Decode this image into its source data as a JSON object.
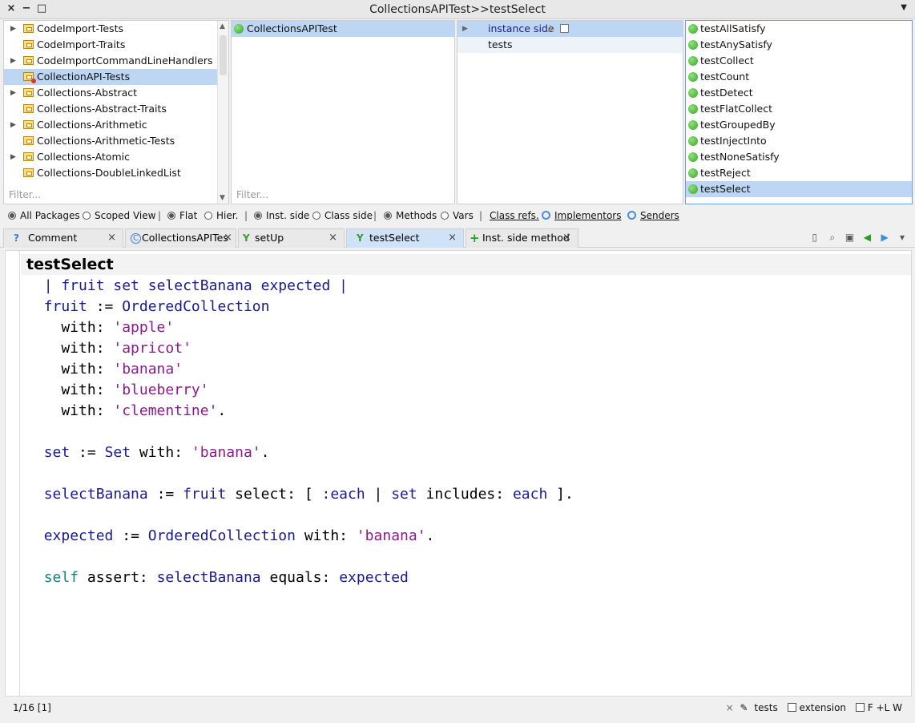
{
  "window": {
    "title": "CollectionsAPITest>>testSelect"
  },
  "packages": {
    "items": [
      {
        "label": "CodeImport-Tests",
        "expandable": true
      },
      {
        "label": "CodeImport-Traits",
        "expandable": false
      },
      {
        "label": "CodeImportCommandLineHandlers",
        "expandable": true
      },
      {
        "label": "CollectionAPI-Tests",
        "expandable": false
      },
      {
        "label": "Collections-Abstract",
        "expandable": true
      },
      {
        "label": "Collections-Abstract-Traits",
        "expandable": false
      },
      {
        "label": "Collections-Arithmetic",
        "expandable": true
      },
      {
        "label": "Collections-Arithmetic-Tests",
        "expandable": false
      },
      {
        "label": "Collections-Atomic",
        "expandable": true
      },
      {
        "label": "Collections-DoubleLinkedList",
        "expandable": false
      }
    ],
    "filter_placeholder": "Filter..."
  },
  "classes": {
    "items": [
      {
        "label": "CollectionsAPITest"
      }
    ],
    "filter_placeholder": "Filter..."
  },
  "protocols": {
    "items": [
      {
        "label": "instance side"
      },
      {
        "label": "tests"
      }
    ]
  },
  "methods": {
    "items": [
      {
        "label": "testAllSatisfy"
      },
      {
        "label": "testAnySatisfy"
      },
      {
        "label": "testCollect"
      },
      {
        "label": "testCount"
      },
      {
        "label": "testDetect"
      },
      {
        "label": "testFlatCollect"
      },
      {
        "label": "testGroupedBy"
      },
      {
        "label": "testInjectInto"
      },
      {
        "label": "testNoneSatisfy"
      },
      {
        "label": "testReject"
      },
      {
        "label": "testSelect"
      }
    ]
  },
  "toolbar": {
    "all_packages": "All Packages",
    "scoped_view": "Scoped View",
    "flat": "Flat",
    "hier": "Hier.",
    "inst_side": "Inst. side",
    "class_side": "Class side",
    "methods": "Methods",
    "vars": "Vars",
    "class_refs": "Class refs.",
    "implementors": "Implementors",
    "senders": "Senders"
  },
  "tabs": {
    "comment": {
      "icon": "?",
      "label": "Comment"
    },
    "class_tab": {
      "icon": "C",
      "label": "CollectionsAPITes"
    },
    "setup": {
      "icon": "Y",
      "label": "setUp"
    },
    "testselect": {
      "icon": "Y",
      "label": "testSelect"
    },
    "new_method": {
      "icon": "+",
      "label": "Inst. side method"
    }
  },
  "editor": {
    "selector": "testSelect",
    "temps": "| fruit set selectBanana expected |",
    "strings": [
      "'apple'",
      "'apricot'",
      "'banana'",
      "'blueberry'",
      "'clementine'"
    ]
  },
  "status": {
    "position": "1/16 [1]",
    "protocol": "tests",
    "extension": "extension",
    "flags": "F  +L  W"
  }
}
